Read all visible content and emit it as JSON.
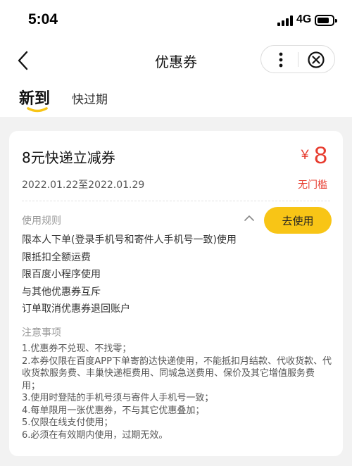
{
  "status_bar": {
    "time": "5:04",
    "network": "4G"
  },
  "nav": {
    "title": "优惠券",
    "back_icon": "chevron-left-icon",
    "more_icon": "more-vertical-icon",
    "close_icon": "close-circle-icon"
  },
  "tabs": [
    {
      "label": "新到",
      "active": true
    },
    {
      "label": "快过期",
      "active": false
    }
  ],
  "colors": {
    "accent_yellow": "#f8c516",
    "price_red": "#e73c2f",
    "background": "#f2f2f2"
  },
  "coupon": {
    "title": "8元快递立减券",
    "dates": "2022.01.22至2022.01.29",
    "currency": "￥",
    "amount": "8",
    "threshold": "无门槛",
    "use_button": "去使用",
    "rules_label": "使用规则",
    "rules": [
      "限本人下单(登录手机号和寄件人手机号一致)使用",
      "限抵扣全额运费",
      "限百度小程序使用",
      "与其他优惠券互斥",
      "订单取消优惠券退回账户"
    ],
    "notes_label": "注意事项",
    "notes": [
      "1.优惠券不兑现、不找零；",
      "2.本券仅限在百度APP下单寄韵达快递使用，不能抵扣月结款、代收货款、代收货款服务费、丰巢快递柜费用、同城急送费用、保价及其它增值服务费用；",
      "3.使用时登陆的手机号须与寄件人手机号一致；",
      "4.每单限用一张优惠券，不与其它优惠叠加；",
      "5.仅限在线支付使用；",
      "6.必须在有效期内使用，过期无效。"
    ]
  }
}
